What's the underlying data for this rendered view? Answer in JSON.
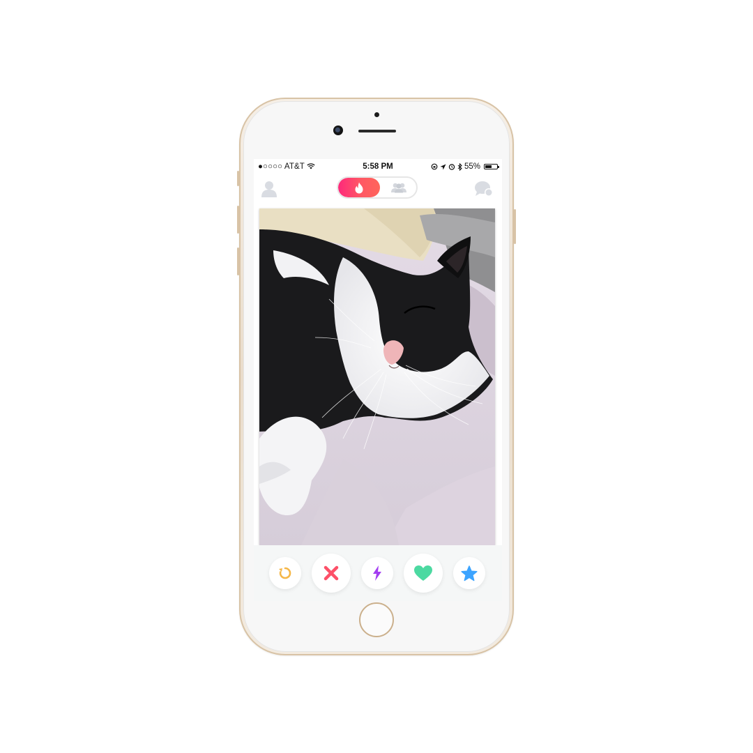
{
  "status_bar": {
    "signal": "●○○○○",
    "carrier": "AT&T",
    "time": "5:58 PM",
    "battery_percent": "55%",
    "battery_level": 0.55
  },
  "nav": {
    "left_icon": "profile-icon",
    "center_toggle": {
      "active": "flame-icon",
      "inactive": "group-icon"
    },
    "right_icon": "chat-icon"
  },
  "card": {
    "photo_subject": "sleeping black-and-white cat"
  },
  "actions": [
    {
      "name": "rewind-button",
      "icon": "rewind-icon",
      "color": "#f5b748"
    },
    {
      "name": "nope-button",
      "icon": "close-icon",
      "color": "#fd5068"
    },
    {
      "name": "boost-button",
      "icon": "lightning-icon",
      "color": "#a33df1"
    },
    {
      "name": "like-button",
      "icon": "heart-icon",
      "color": "#4cd9a1"
    },
    {
      "name": "super-like-button",
      "icon": "star-icon",
      "color": "#3ca4ff"
    }
  ],
  "colors": {
    "brand_gradient_start": "#fd297b",
    "brand_gradient_end": "#ff655b",
    "phone_gold": "#d8c3a6"
  }
}
